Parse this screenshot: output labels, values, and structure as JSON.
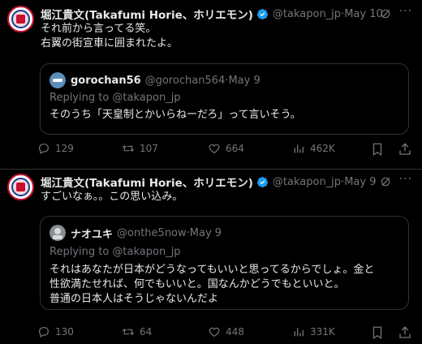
{
  "tweets": [
    {
      "author_name": "堀江貴文(Takafumi Horie、ホリエモン)",
      "handle": "@takapon_jp",
      "date": "May 10",
      "text": "それ前から言ってる笑。\n右翼の街宣車に囲まれたよ。",
      "quote": {
        "author_name": "gorochan56",
        "handle": "@gorochan564",
        "date": "May 9",
        "replying_to": "Replying to @takapon_jp",
        "text": "そのうち「天皇制とかいらねーだろ」って言いそう。"
      },
      "stats": {
        "replies": "129",
        "reposts": "107",
        "likes": "664",
        "views": "462K"
      }
    },
    {
      "author_name": "堀江貴文(Takafumi Horie、ホリエモン)",
      "handle": "@takapon_jp",
      "date": "May 9",
      "text": "すごいなぁ。。この思い込み。",
      "quote": {
        "author_name": "ナオユキ",
        "handle": "@onthe5now",
        "date": "May 9",
        "replying_to": "Replying to @takapon_jp",
        "text": "それはあなたが日本がどうなってもいいと思ってるからでしょ。金と\n性欲満たせれば、何でもいいと。国なんかどうでもといいと。\n普通の日本人はそうじゃないんだよ"
      },
      "stats": {
        "replies": "130",
        "reposts": "64",
        "likes": "448",
        "views": "331K"
      }
    }
  ],
  "sep": " · ",
  "colors": {
    "background": "#000000",
    "text": "#e7e9ea",
    "muted": "#71767b",
    "border": "#2f3336",
    "verified": "#1d9bf0"
  },
  "icons": [
    "verified-badge-icon",
    "grok-icon",
    "more-icon",
    "reply-icon",
    "repost-icon",
    "like-icon",
    "views-icon",
    "bookmark-icon",
    "share-icon"
  ]
}
